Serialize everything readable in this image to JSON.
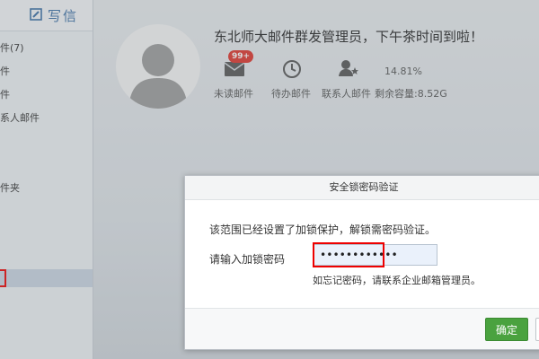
{
  "sidebar": {
    "compose_label": "写信",
    "items": [
      {
        "label": "件(7)"
      },
      {
        "label": "件"
      },
      {
        "label": "件"
      },
      {
        "label": "系人邮件"
      },
      {
        "label": "件夹"
      }
    ]
  },
  "profile": {
    "greeting": "东北师大邮件群发管理员，下午茶时间到啦！",
    "stats": [
      {
        "label": "未读邮件",
        "icon": "envelope-icon",
        "badge": "99+"
      },
      {
        "label": "待办邮件",
        "icon": "clock-icon"
      },
      {
        "label": "联系人邮件",
        "icon": "contact-star-icon"
      }
    ],
    "storage": {
      "percent": "14.81%",
      "remaining_label": "剩余容量:8.52G",
      "used_fraction": 0.1481
    }
  },
  "dialog": {
    "title": "安全锁密码验证",
    "message": "该范围已经设置了加锁保护，解锁需密码验证。",
    "password_label": "请输入加锁密码",
    "password_value": "••••••••••••",
    "forgot_text": "如忘记密码，请联系企业邮箱管理员。",
    "ok_label": "确定",
    "cancel_label": ""
  },
  "colors": {
    "accent_green": "#4aa23f",
    "highlight_red": "#e00000",
    "badge_red": "#e0332a",
    "link_blue": "#3a6ea5"
  }
}
